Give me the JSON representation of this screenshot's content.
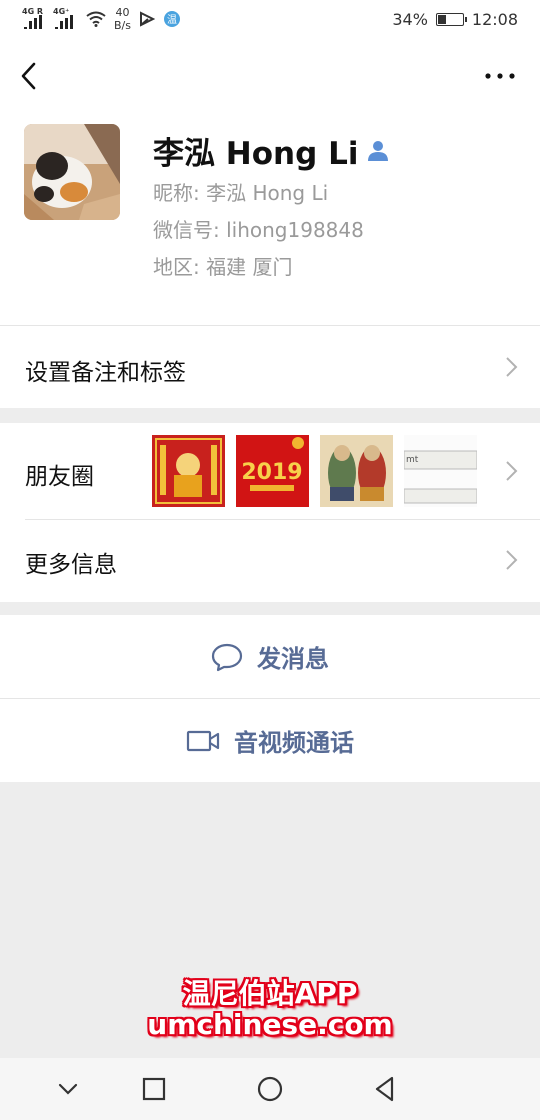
{
  "status": {
    "left_tag1": "4G R",
    "left_tag2": "4G⁺",
    "speed_value": "40",
    "speed_unit": "B/s",
    "battery": "34%",
    "time": "12:08",
    "battery_level_percent": 34
  },
  "profile": {
    "name": "李泓 Hong Li",
    "nickname": "昵称:  李泓 Hong Li",
    "wechat_id": "微信号:  lihong198848",
    "region": "地区:  福建  厦门"
  },
  "cells": {
    "remark": "设置备注和标签",
    "moments": "朋友圈",
    "more_info": "更多信息"
  },
  "moments_thumbs": {
    "thumb2_text": "2019",
    "thumb4_text": "mt"
  },
  "actions": {
    "send_message": "发消息",
    "video_call": "音视频通话"
  },
  "watermark": {
    "line1": "温尼伯站APP",
    "line2": "umchinese.com"
  },
  "colors": {
    "accent_link": "#576b95",
    "background": "#ededed",
    "watermark_red": "#e2001a"
  }
}
